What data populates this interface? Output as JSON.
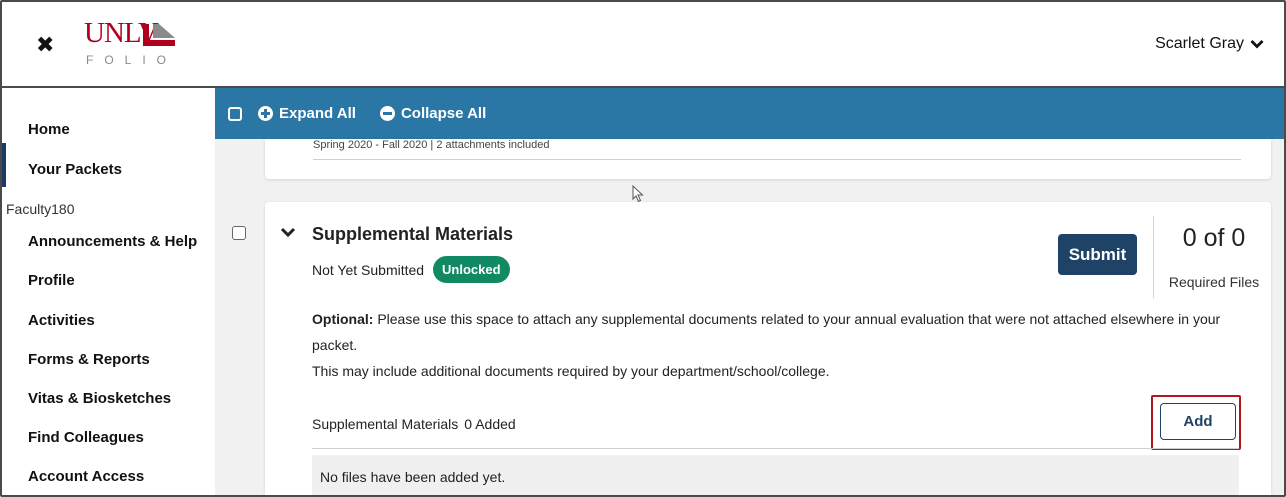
{
  "header": {
    "close_icon": "close-x-icon",
    "logo": {
      "main": "UNLV",
      "sub": "FOLIO"
    },
    "user_name": "Scarlet Gray"
  },
  "sidebar": {
    "items": [
      {
        "label": "Home"
      },
      {
        "label": "Your Packets",
        "active": true
      }
    ],
    "group_label": "Faculty180",
    "group_items": [
      {
        "label": "Announcements & Help"
      },
      {
        "label": "Profile"
      },
      {
        "label": "Activities"
      },
      {
        "label": "Forms & Reports"
      },
      {
        "label": "Vitas & Biosketches"
      },
      {
        "label": "Find Colleagues"
      },
      {
        "label": "Account Access"
      }
    ]
  },
  "toolbar": {
    "expand_all": "Expand All",
    "collapse_all": "Collapse All"
  },
  "previous_section": {
    "subtitle": "Spring 2020 - Fall 2020 | 2 attachments included"
  },
  "section": {
    "title": "Supplemental Materials",
    "status": "Not Yet Submitted",
    "badge": "Unlocked",
    "submit_label": "Submit",
    "count": "0 of 0",
    "count_label": "Required Files",
    "description_bold": "Optional:",
    "description_line1": " Please use this space to attach any supplemental documents related to your annual evaluation that were not attached elsewhere in your packet.",
    "description_line2": "This may include additional documents required by your department/school/college.",
    "list_title": "Supplemental Materials",
    "list_count": "0 Added",
    "add_label": "Add",
    "empty_text": "No files have been added yet."
  },
  "colors": {
    "toolbar": "#2a77a6",
    "primary_button": "#1f4366",
    "badge": "#118a63",
    "logo_red": "#b1001f",
    "highlight": "#b4161d"
  }
}
